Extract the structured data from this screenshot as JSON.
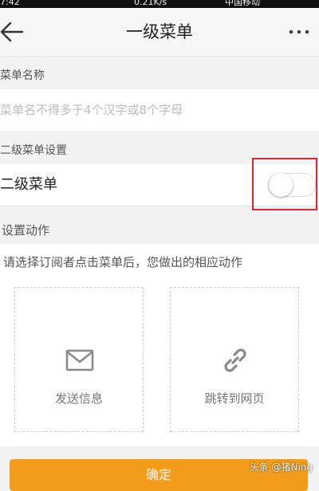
{
  "status_bar": {
    "time": "7:42",
    "speed": "0.21K/s",
    "carrier": "中国移动"
  },
  "header": {
    "title": "一级菜单",
    "back_icon": "back-arrow-icon",
    "more_icon": "more-dots-icon"
  },
  "menu_name": {
    "section_label": "菜单名称",
    "placeholder": "菜单名不得多于4个汉字或8个字母",
    "value": ""
  },
  "submenu": {
    "section_label": "二级菜单设置",
    "toggle_label": "二级菜单",
    "enabled": false,
    "highlight_color": "#e8232b"
  },
  "action": {
    "section_label": "设置动作",
    "hint": "请选择订阅者点击菜单后，您做出的相应动作",
    "options": [
      {
        "label": "发送信息",
        "icon": "envelope-icon"
      },
      {
        "label": "跳转到网页",
        "icon": "link-icon"
      }
    ]
  },
  "confirm": {
    "label": "确定",
    "color": "#f39c1b"
  },
  "watermark": "头条 @猪Ning"
}
